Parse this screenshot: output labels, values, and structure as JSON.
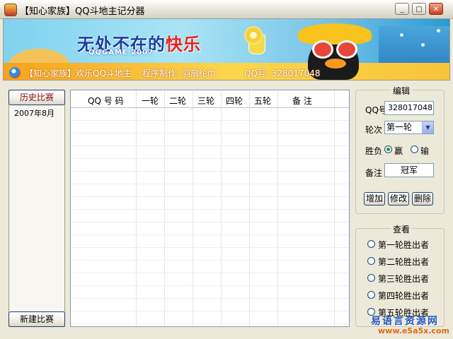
{
  "window": {
    "title": "【知心家族】QQ斗地主记分器",
    "buttons": {
      "minimize": "_",
      "maximize": "□",
      "close": "✕"
    }
  },
  "banner": {
    "slogan_part1": "无处不在的",
    "slogan_part2": "快乐",
    "subslogan": "QQGAME 2007",
    "family_text": "【知心家族】欢乐QQ斗地主",
    "author_text": "程序制作: 羽扇纶巾",
    "qq_text": "QQ号: 328017048"
  },
  "left_panel": {
    "history_button": "历史比赛",
    "history_items": [
      "2007年8月"
    ],
    "new_button": "新建比赛"
  },
  "grid": {
    "columns": [
      "QQ 号 码",
      "一轮",
      "二轮",
      "三轮",
      "四轮",
      "五轮",
      "备  注"
    ]
  },
  "edit": {
    "title": "编辑",
    "qq_label": "QQ号",
    "qq_value": "328017048",
    "round_label": "轮次",
    "round_value": "第一轮",
    "result_label": "胜负",
    "win_label": "赢",
    "lose_label": "输",
    "win_selected": true,
    "note_label": "备注",
    "note_value": "冠军",
    "add_button": "增加",
    "modify_button": "修改",
    "delete_button": "删除"
  },
  "view": {
    "title": "查看",
    "options": [
      "第一轮胜出者",
      "第二轮胜出者",
      "第三轮胜出者",
      "第四轮胜出者",
      "第五轮胜出者"
    ]
  },
  "watermark": {
    "cn": "易语言资源网",
    "url": "www.e5a5x.com"
  }
}
